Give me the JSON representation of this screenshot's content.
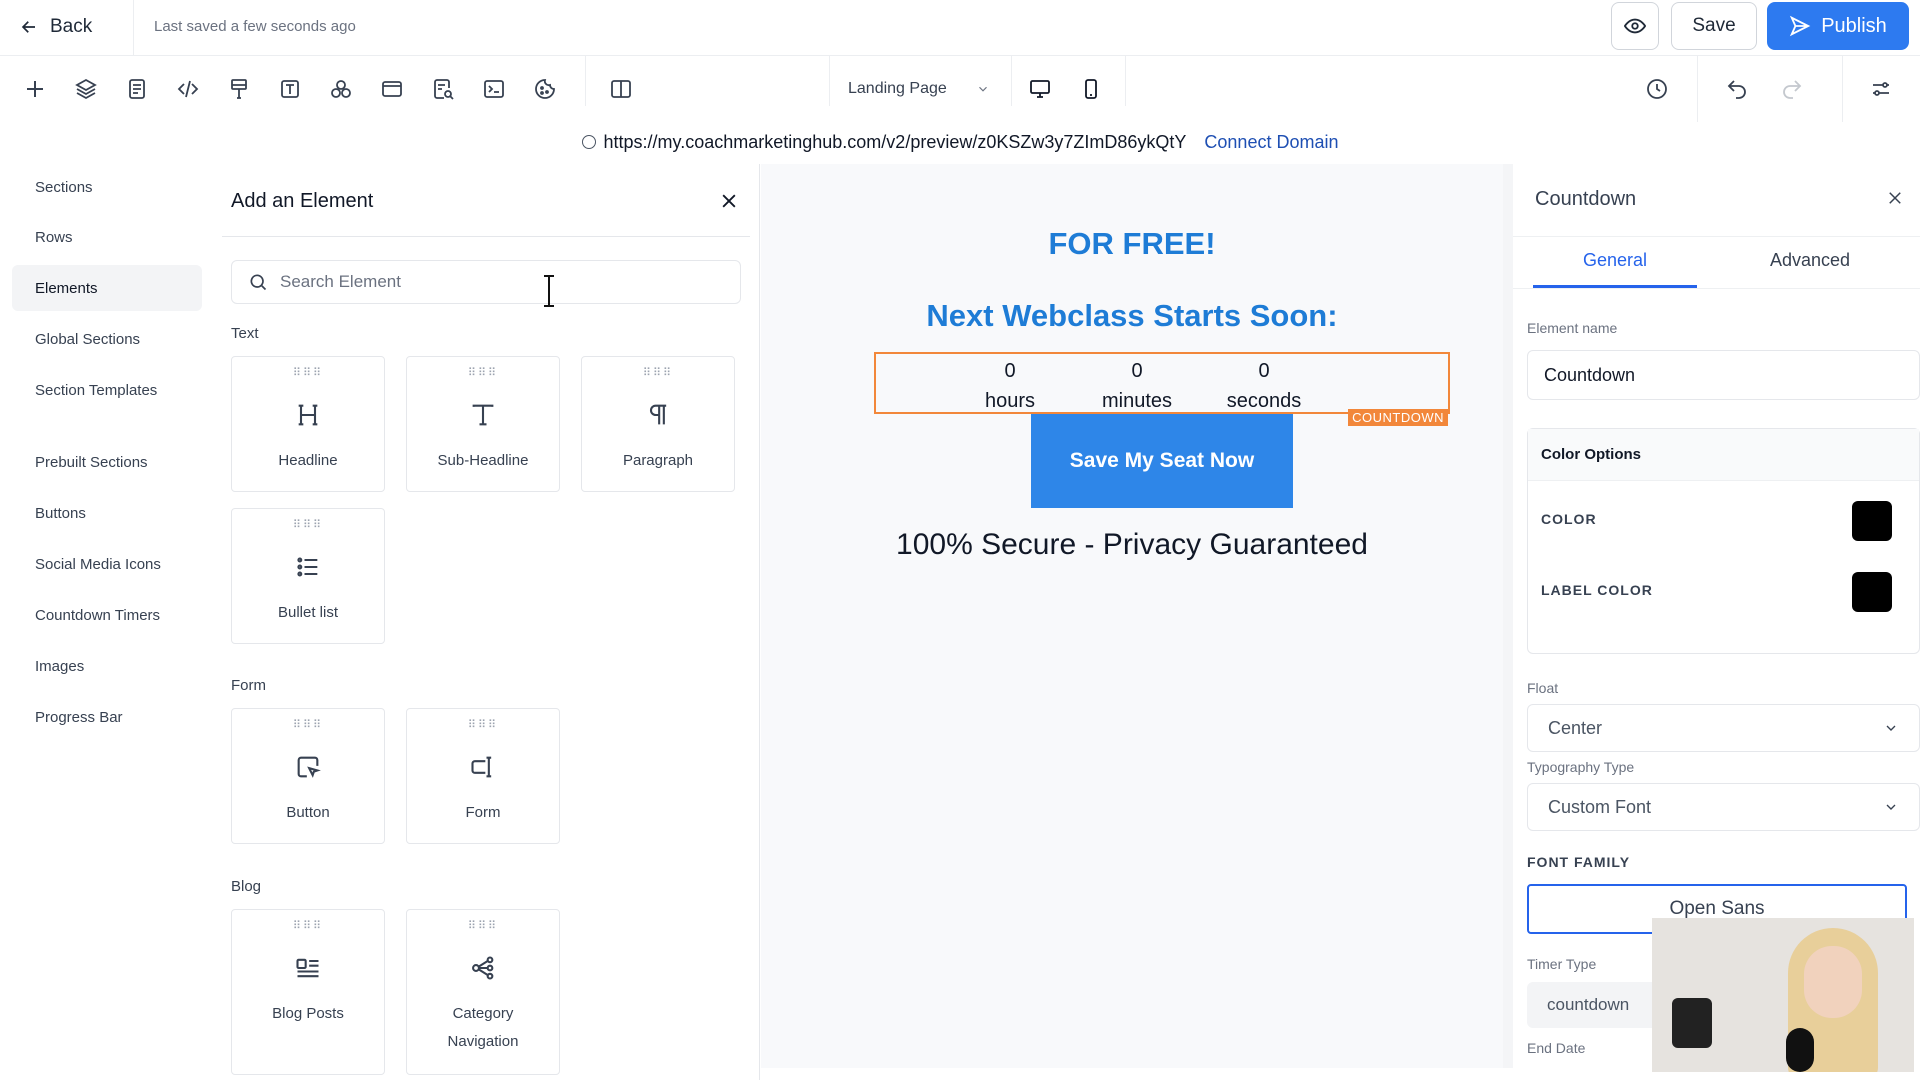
{
  "header": {
    "back_label": "Back",
    "saved_status": "Last saved a few seconds ago",
    "save_label": "Save",
    "publish_label": "Publish"
  },
  "toolbar": {
    "icons": [
      "plus-icon",
      "layers-icon",
      "page-icon",
      "code-icon",
      "brush-icon",
      "text-icon",
      "shapes-icon",
      "layout-icon",
      "search-doc-icon",
      "terminal-icon",
      "cookie-icon",
      "columns-icon"
    ],
    "page_select": "Landing Page",
    "right_icons": [
      "desktop-icon",
      "mobile-icon",
      "history-icon",
      "undo-icon",
      "redo-icon",
      "settings-icon"
    ]
  },
  "url_bar": {
    "url": "https://my.coachmarketinghub.com/v2/preview/z0KSZw3y7ZImD86ykQtY",
    "connect_label": "Connect Domain"
  },
  "left_nav": {
    "items": [
      {
        "label": "Sections"
      },
      {
        "label": "Rows"
      },
      {
        "label": "Elements"
      },
      {
        "label": "Global Sections"
      },
      {
        "label": "Section Templates"
      },
      {
        "label": "Prebuilt Sections"
      },
      {
        "label": "Buttons"
      },
      {
        "label": "Social Media Icons"
      },
      {
        "label": "Countdown Timers"
      },
      {
        "label": "Images"
      },
      {
        "label": "Progress Bar"
      }
    ],
    "active": "Elements"
  },
  "add_panel": {
    "title": "Add an Element",
    "search_placeholder": "Search Element",
    "categories": [
      {
        "label": "Text",
        "items": [
          {
            "label": "Headline",
            "icon": "headline-icon"
          },
          {
            "label": "Sub-Headline",
            "icon": "sub-headline-icon"
          },
          {
            "label": "Paragraph",
            "icon": "paragraph-icon"
          },
          {
            "label": "Bullet list",
            "icon": "bullet-list-icon"
          }
        ]
      },
      {
        "label": "Form",
        "items": [
          {
            "label": "Button",
            "icon": "button-icon"
          },
          {
            "label": "Form",
            "icon": "form-icon"
          }
        ]
      },
      {
        "label": "Blog",
        "items": [
          {
            "label": "Blog Posts",
            "icon": "blog-posts-icon"
          },
          {
            "label": "Category Navigation",
            "icon": "category-nav-icon"
          }
        ]
      }
    ]
  },
  "canvas": {
    "for_free": "FOR FREE!",
    "webclass_heading": "Next Webclass Starts Soon:",
    "countdown": {
      "units": [
        {
          "value": "0",
          "label": "hours"
        },
        {
          "value": "0",
          "label": "minutes"
        },
        {
          "value": "0",
          "label": "seconds"
        }
      ],
      "tag": "COUNTDOWN",
      "highlight_color": "#f2873a"
    },
    "cta_label": "Save My Seat Now",
    "secure_text": "100% Secure - Privacy Guaranteed"
  },
  "settings_panel": {
    "title": "Countdown",
    "tabs": [
      "General",
      "Advanced"
    ],
    "active_tab": "General",
    "element_name_label": "Element name",
    "element_name_value": "Countdown",
    "color_options": {
      "title": "Color Options",
      "color_label": "COLOR",
      "color_value": "#000000",
      "label_color_label": "LABEL COLOR",
      "label_color_value": "#000000"
    },
    "float_label": "Float",
    "float_value": "Center",
    "typography_label": "Typography Type",
    "typography_value": "Custom Font",
    "font_family_label": "FONT FAMILY",
    "font_family_value": "Open Sans",
    "timer_type_label": "Timer Type",
    "timer_type_value": "countdown",
    "end_date_label": "End Date"
  },
  "colors": {
    "accent": "#2d7af0",
    "heading_blue": "#1e7cd6",
    "cta_blue": "#2e86e8"
  }
}
